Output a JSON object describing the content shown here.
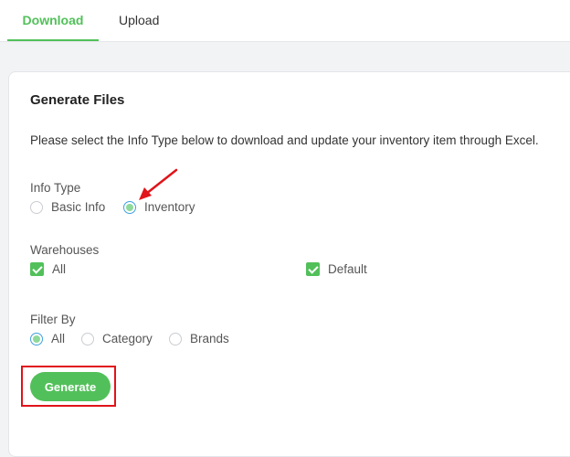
{
  "tabs": [
    {
      "label": "Download",
      "active": true
    },
    {
      "label": "Upload",
      "active": false
    }
  ],
  "card": {
    "title": "Generate Files",
    "description": "Please select the Info Type below to download and update your inventory item through Excel."
  },
  "info_type": {
    "label": "Info Type",
    "options": [
      {
        "label": "Basic Info",
        "checked": false
      },
      {
        "label": "Inventory",
        "checked": true
      }
    ]
  },
  "warehouses": {
    "label": "Warehouses",
    "options": [
      {
        "label": "All",
        "checked": true
      },
      {
        "label": "Default",
        "checked": true
      }
    ]
  },
  "filter_by": {
    "label": "Filter By",
    "options": [
      {
        "label": "All",
        "checked": true
      },
      {
        "label": "Category",
        "checked": false
      },
      {
        "label": "Brands",
        "checked": false
      }
    ]
  },
  "generate_button": {
    "label": "Generate"
  },
  "colors": {
    "accent": "#52c05a",
    "annotation": "#e0141a",
    "radio_ring": "#3f9fe0"
  },
  "icons": [
    "checkbox-checked-icon",
    "radio-selected-icon",
    "annotation-arrow-icon"
  ]
}
